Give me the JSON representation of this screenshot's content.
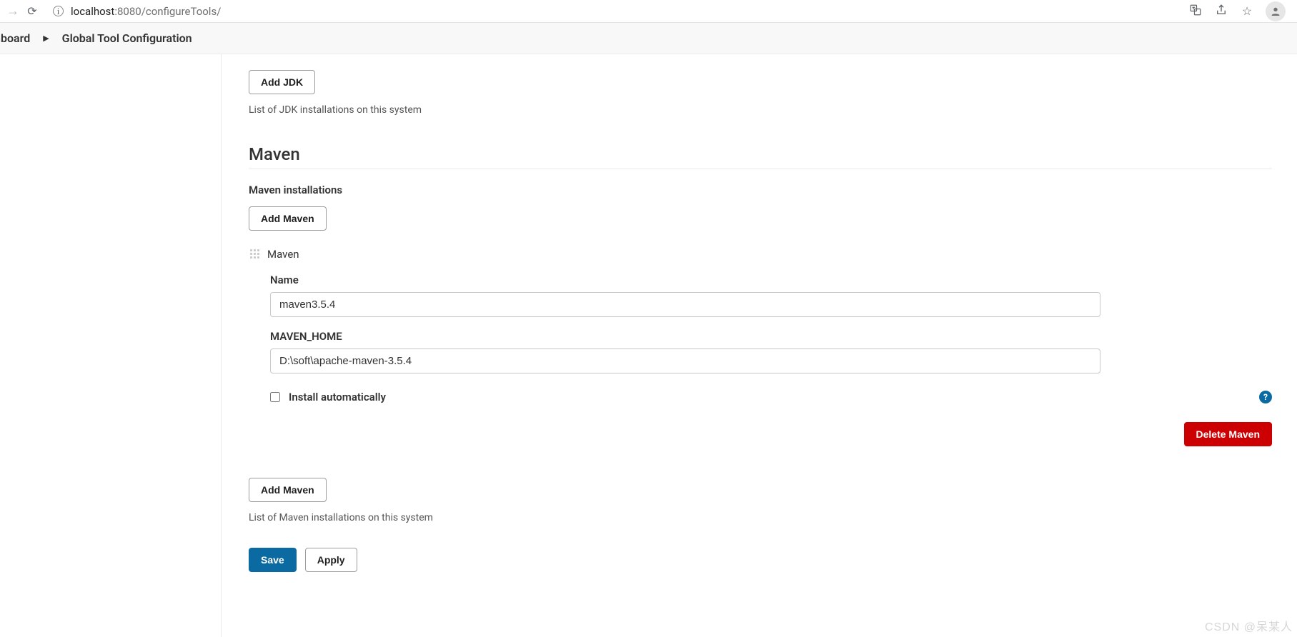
{
  "browser": {
    "url_host": "localhost",
    "url_port": ":8080",
    "url_path": "/configureTools/"
  },
  "breadcrumb": {
    "item0": "nboard",
    "item1": "Global Tool Configuration"
  },
  "jdk": {
    "add_label": "Add JDK",
    "helper": "List of JDK installations on this system"
  },
  "maven": {
    "section_title": "Maven",
    "installations_label": "Maven installations",
    "add_label": "Add Maven",
    "install_title": "Maven",
    "name_label": "Name",
    "name_value": "maven3.5.4",
    "home_label": "MAVEN_HOME",
    "home_value": "D:\\soft\\apache-maven-3.5.4",
    "auto_install_label": "Install automatically",
    "delete_label": "Delete Maven",
    "add_label2": "Add Maven",
    "helper2": "List of Maven installations on this system"
  },
  "actions": {
    "save": "Save",
    "apply": "Apply"
  },
  "watermark": "CSDN @呆某人"
}
